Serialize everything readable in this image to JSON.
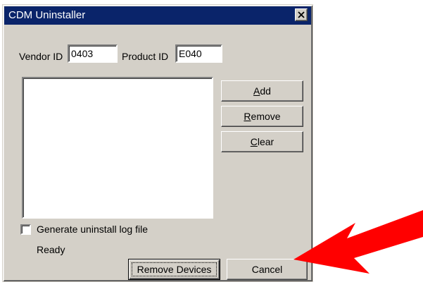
{
  "window": {
    "title": "CDM Uninstaller",
    "close_glyph": "×"
  },
  "ids": {
    "vendor_label": "Vendor ID",
    "vendor_value": "0403",
    "product_label": "Product ID",
    "product_value": "E040"
  },
  "buttons": {
    "add": {
      "mnemonic": "A",
      "rest": "dd"
    },
    "remove": {
      "mnemonic": "R",
      "rest": "emove"
    },
    "clear": {
      "mnemonic": "C",
      "rest": "lear"
    },
    "remove_devices": "Remove Devices",
    "cancel": "Cancel"
  },
  "options": {
    "log_label": "Generate uninstall log file",
    "log_checked": false
  },
  "status": {
    "text": "Ready"
  },
  "colors": {
    "face": "#d4d0c8",
    "titlebar": "#0a246a",
    "arrow": "#ff0000"
  },
  "icons": {
    "close": "close-icon",
    "arrow": "red-arrow-pointer-icon"
  }
}
